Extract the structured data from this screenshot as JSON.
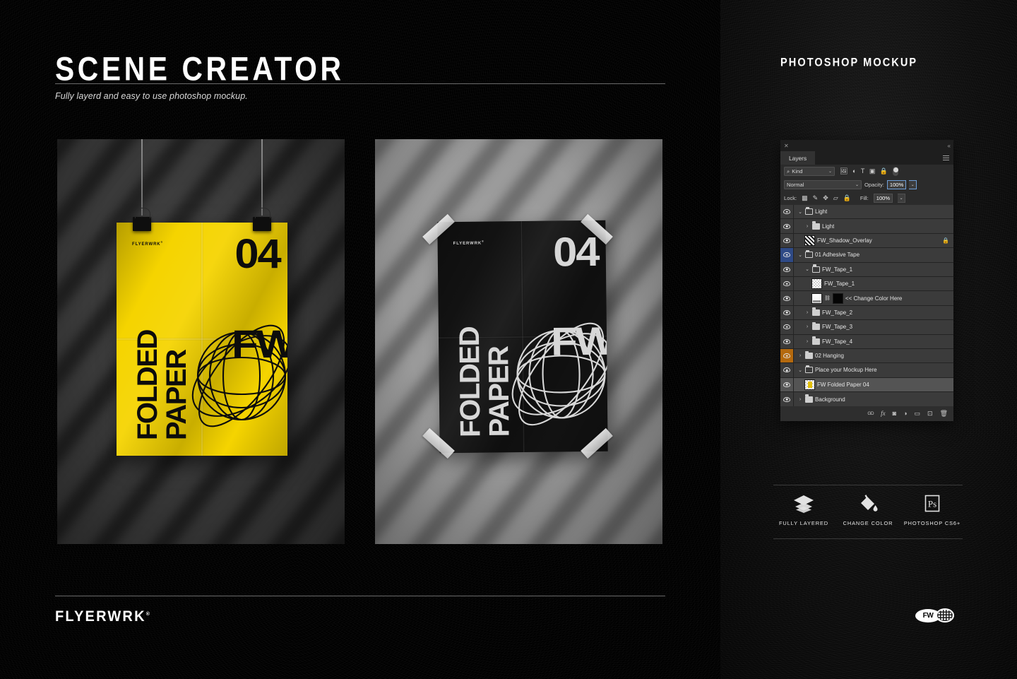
{
  "header": {
    "title": "SCENE CREATOR",
    "subtitle": "Fully layerd and easy to use photoshop mockup.",
    "right_title": "PHOTOSHOP MOCKUP"
  },
  "footer": {
    "brand": "FLYERWRK",
    "brand_mark": "®",
    "logo_text": "FW"
  },
  "posters": [
    {
      "variant": "yellow",
      "brand": "FLYERWRK",
      "brand_mark": "®",
      "number": "04",
      "word_1": "FOLDED",
      "word_2": "PAPER",
      "mark": "FW",
      "paper_color": "#f5d400",
      "ink_color": "#0c0c0c",
      "backdrop_color": "#3a3a3a",
      "mount": "binder-clips"
    },
    {
      "variant": "black",
      "brand": "FLYERWRK",
      "brand_mark": "®",
      "number": "04",
      "word_1": "FOLDED",
      "word_2": "PAPER",
      "mark": "FW",
      "paper_color": "#121212",
      "ink_color": "#d7d7d7",
      "backdrop_color": "#9a9a9a",
      "mount": "adhesive-tape"
    }
  ],
  "photoshop": {
    "close_glyph": "✕",
    "collapse_glyph": "«",
    "tab_label": "Layers",
    "filter": {
      "kind_label": "Kind",
      "search_glyph": "⌕",
      "caret_glyph": "⌄",
      "icons": [
        "pixel-layer",
        "adjustment-layer",
        "type-layer",
        "shape-layer",
        "smart-object"
      ]
    },
    "blend": {
      "mode": "Normal",
      "caret_glyph": "⌄",
      "opacity_label": "Opacity:",
      "opacity_value": "100%"
    },
    "lock": {
      "label": "Lock:",
      "fill_label": "Fill:",
      "fill_value": "100%",
      "icons": [
        "transparency",
        "brush",
        "move",
        "artboard",
        "lock-all"
      ]
    },
    "layers": [
      {
        "name": "Light",
        "indent": 1,
        "type": "group",
        "twisty": "⌄",
        "expanded": true,
        "visible": true,
        "highlight": "none",
        "selected": false
      },
      {
        "name": "Light",
        "indent": 2,
        "type": "group",
        "twisty": "›",
        "expanded": false,
        "visible": true,
        "highlight": "none",
        "selected": false
      },
      {
        "name": "FW_Shadow_Overlay",
        "indent": 2,
        "type": "layer",
        "thumb": "stripes",
        "visible": true,
        "locked": true,
        "highlight": "none",
        "selected": false
      },
      {
        "name": "01 Adhesive Tape",
        "indent": 1,
        "type": "group",
        "twisty": "⌄",
        "expanded": true,
        "visible": true,
        "highlight": "blue",
        "selected": false
      },
      {
        "name": "FW_Tape_1",
        "indent": 2,
        "type": "group",
        "twisty": "⌄",
        "expanded": true,
        "visible": true,
        "highlight": "none",
        "selected": false
      },
      {
        "name": "FW_Tape_1",
        "indent": 3,
        "type": "layer",
        "thumb": "checker",
        "visible": true,
        "highlight": "none",
        "selected": false
      },
      {
        "name": "<< Change Color Here",
        "indent": 3,
        "type": "layer-mask",
        "thumb": "white",
        "mask_thumb": "black",
        "link": "⛓",
        "visible": true,
        "highlight": "none",
        "selected": false
      },
      {
        "name": "FW_Tape_2",
        "indent": 2,
        "type": "group",
        "twisty": "›",
        "expanded": false,
        "visible": true,
        "highlight": "none",
        "selected": false
      },
      {
        "name": "FW_Tape_3",
        "indent": 2,
        "type": "group",
        "twisty": "›",
        "expanded": false,
        "visible": true,
        "highlight": "none",
        "selected": false
      },
      {
        "name": "FW_Tape_4",
        "indent": 2,
        "type": "group",
        "twisty": "›",
        "expanded": false,
        "visible": true,
        "highlight": "none",
        "selected": false
      },
      {
        "name": "02 Hanging",
        "indent": 1,
        "type": "group",
        "twisty": "›",
        "expanded": false,
        "visible": true,
        "highlight": "orange",
        "selected": false
      },
      {
        "name": "Place your Mockup Here",
        "indent": 1,
        "type": "group",
        "twisty": "⌄",
        "expanded": true,
        "visible": true,
        "highlight": "none",
        "selected": false
      },
      {
        "name": "FW Folded Paper 04",
        "indent": 2,
        "type": "smart-object",
        "thumb": "yellowdoc",
        "visible": true,
        "highlight": "none",
        "selected": true
      },
      {
        "name": "Background",
        "indent": 1,
        "type": "group",
        "twisty": "›",
        "expanded": false,
        "visible": true,
        "highlight": "none",
        "selected": false
      }
    ],
    "bottom_icons": [
      "link-layers",
      "add-fx",
      "add-mask",
      "adjustment",
      "new-group",
      "new-layer",
      "delete-layer"
    ],
    "bottom_glyphs": [
      "GD",
      "fx",
      "◙",
      "◑",
      "▭",
      "⊡",
      "🗑"
    ]
  },
  "features": [
    {
      "label": "FULLY LAYERED",
      "icon": "layers-stack-icon"
    },
    {
      "label": "CHANGE COLOR",
      "icon": "paint-bucket-icon"
    },
    {
      "label": "PHOTOSHOP CS6+",
      "icon": "photoshop-ps-icon",
      "badge": "Ps"
    }
  ]
}
